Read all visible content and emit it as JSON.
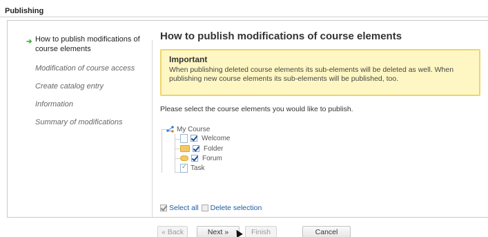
{
  "page": {
    "title": "Publishing"
  },
  "steps": [
    {
      "label": "How to publish modifications of course elements",
      "active": true
    },
    {
      "label": "Modification of course access",
      "active": false
    },
    {
      "label": "Create catalog entry",
      "active": false
    },
    {
      "label": "Information",
      "active": false
    },
    {
      "label": "Summary of modifications",
      "active": false
    }
  ],
  "main": {
    "heading": "How to publish modifications of course elements",
    "alert": {
      "title": "Important",
      "text": "When publishing deleted course elements its sub-elements will be deleted as well. When publishing new course elements its sub-elements will be published, too."
    },
    "prompt": "Please select the course elements you would like to publish.",
    "tree": {
      "root": "My Course",
      "items": [
        {
          "label": "Welcome",
          "icon": "document-icon",
          "checked": true,
          "selectable": true
        },
        {
          "label": "Folder",
          "icon": "folder-icon",
          "checked": true,
          "selectable": true
        },
        {
          "label": "Forum",
          "icon": "forum-icon",
          "checked": true,
          "selectable": true
        },
        {
          "label": "Task",
          "icon": "task-icon",
          "checked": false,
          "selectable": false
        }
      ]
    },
    "select_all": "Select all",
    "delete_selection": "Delete selection"
  },
  "footer": {
    "back": "« Back",
    "next": "Next »",
    "finish": "Finish",
    "cancel": "Cancel"
  },
  "colors": {
    "alert_bg": "#fff7c3",
    "alert_border": "#f0d468",
    "link": "#1a5aa5",
    "active_arrow": "#3aaa35"
  }
}
